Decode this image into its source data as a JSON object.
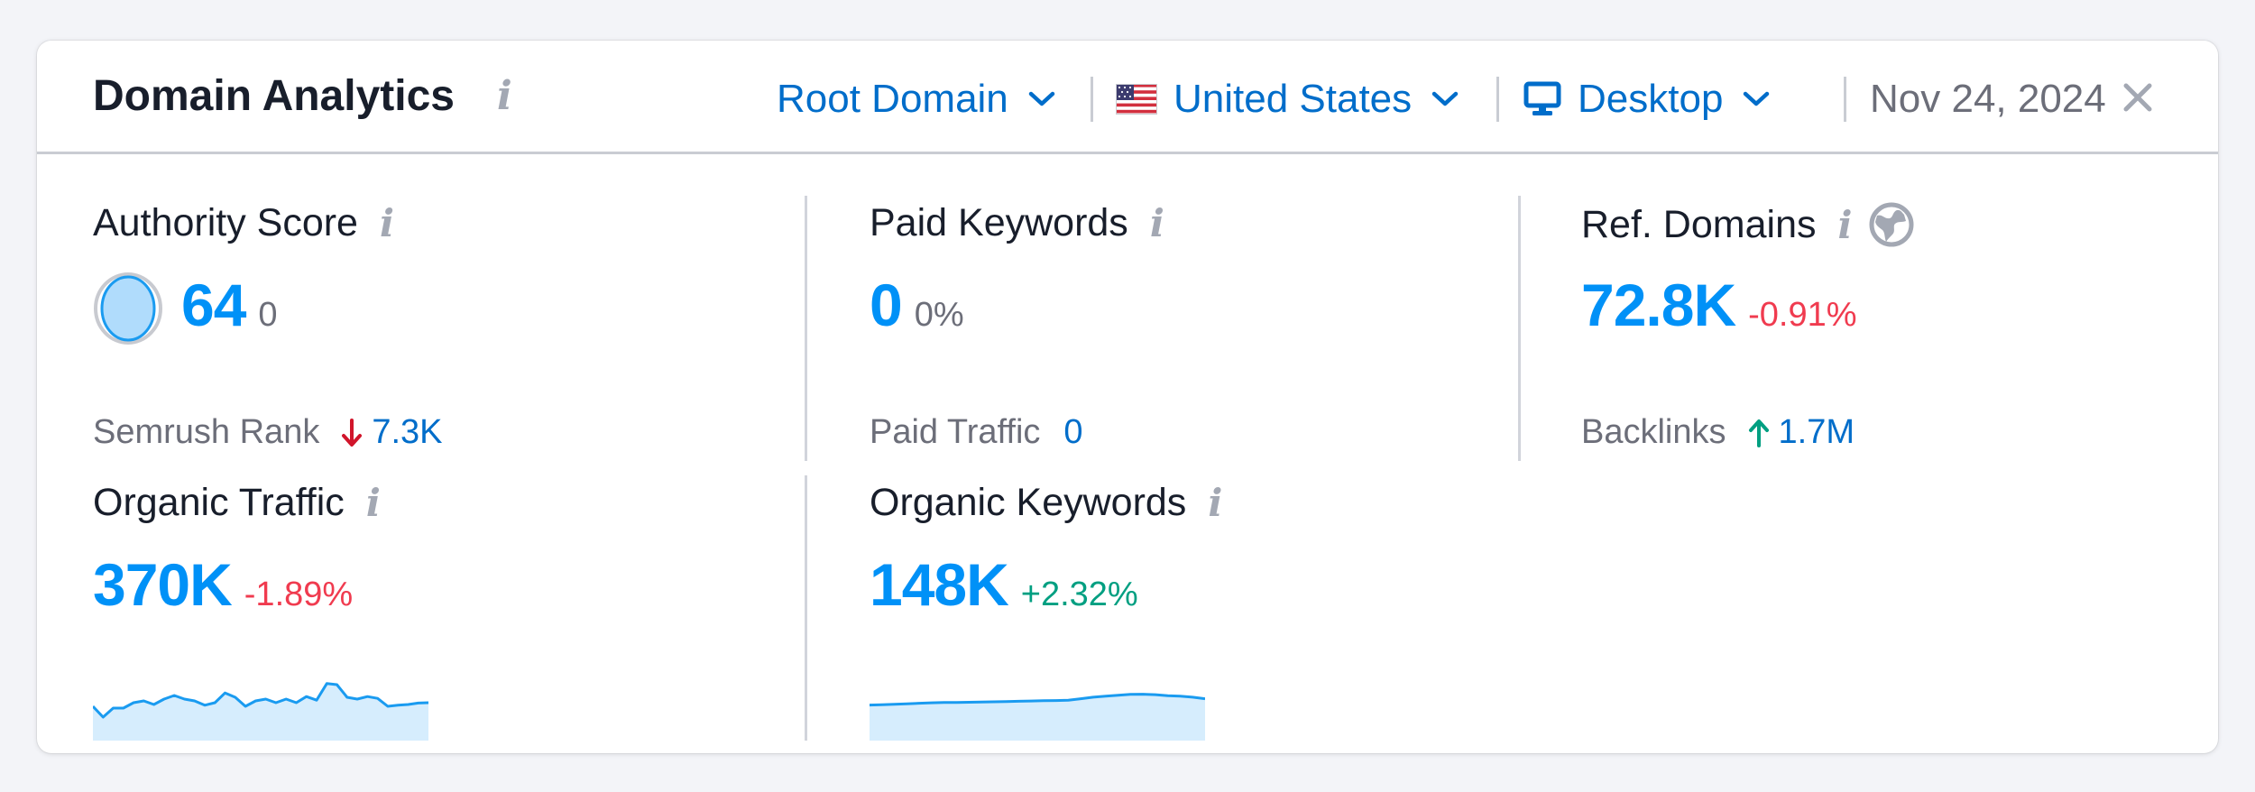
{
  "header": {
    "title": "Domain Analytics",
    "scope_selector": "Root Domain",
    "country_selector": "United States",
    "device_selector": "Desktop",
    "date": "Nov 24, 2024"
  },
  "authority_score": {
    "label": "Authority Score",
    "value": "64",
    "change": "0",
    "rank_label": "Semrush Rank",
    "rank_value": "7.3K",
    "rank_trend": "down"
  },
  "paid_keywords": {
    "label": "Paid Keywords",
    "value": "0",
    "change": "0%",
    "traffic_label": "Paid Traffic",
    "traffic_value": "0"
  },
  "ref_domains": {
    "label": "Ref. Domains",
    "value": "72.8K",
    "change": "-0.91%",
    "backlinks_label": "Backlinks",
    "backlinks_value": "1.7M",
    "backlinks_trend": "up"
  },
  "organic_traffic": {
    "label": "Organic Traffic",
    "value": "370K",
    "change": "-1.89%",
    "sparkline": [
      0.35,
      0.05,
      0.3,
      0.3,
      0.45,
      0.5,
      0.4,
      0.55,
      0.65,
      0.55,
      0.5,
      0.38,
      0.45,
      0.72,
      0.6,
      0.35,
      0.5,
      0.55,
      0.45,
      0.55,
      0.45,
      0.62,
      0.52,
      0.98,
      0.95,
      0.6,
      0.55,
      0.62,
      0.57,
      0.35,
      0.38,
      0.4,
      0.44,
      0.45
    ]
  },
  "organic_keywords": {
    "label": "Organic Keywords",
    "value": "148K",
    "change": "+2.32%",
    "sparkline": [
      0.05,
      0.06,
      0.08,
      0.1,
      0.12,
      0.14,
      0.15,
      0.15,
      0.16,
      0.17,
      0.18,
      0.19,
      0.2,
      0.21,
      0.22,
      0.23,
      0.24,
      0.3,
      0.36,
      0.4,
      0.44,
      0.47,
      0.48,
      0.46,
      0.42,
      0.4,
      0.36,
      0.3
    ]
  },
  "colors": {
    "accent": "#0091f7",
    "link": "#006dca",
    "negative": "#f03b4f",
    "positive": "#009f81",
    "sparkline_stroke": "#1a9bf0",
    "sparkline_fill": "#d6edfd"
  },
  "icons": [
    "info-icon",
    "chevron-down-icon",
    "us-flag-icon",
    "desktop-icon",
    "close-icon",
    "authority-score-icon",
    "arrow-down-icon",
    "arrow-up-icon",
    "globe-icon"
  ]
}
